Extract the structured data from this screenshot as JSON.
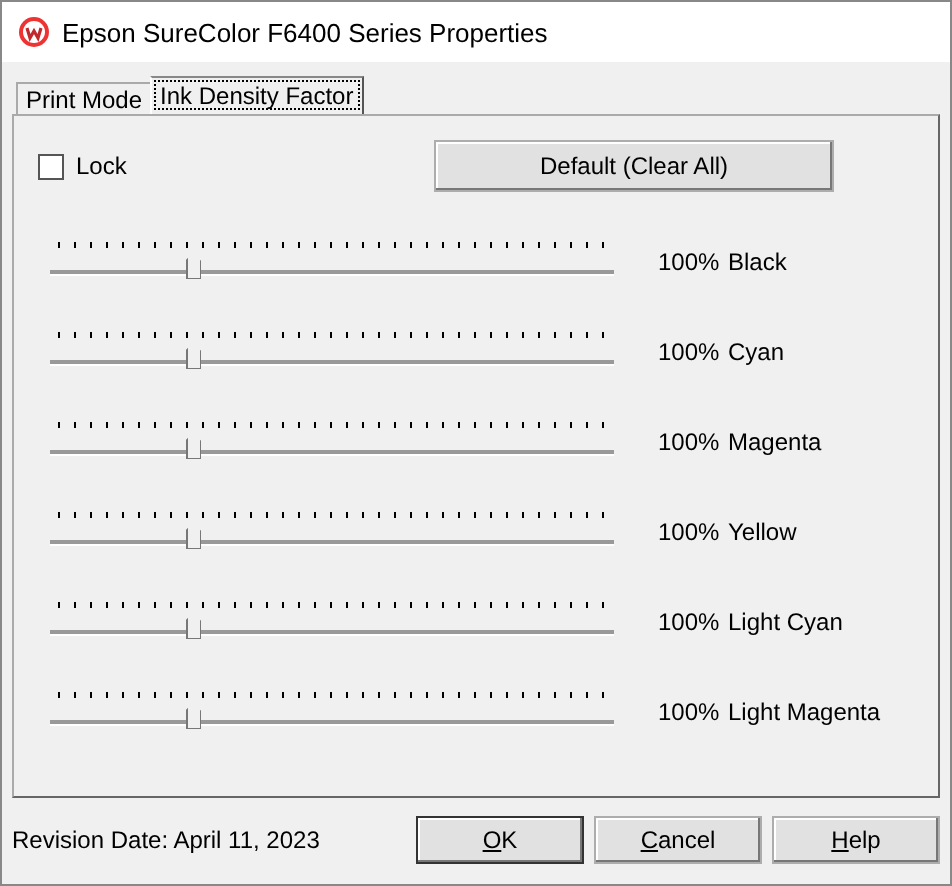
{
  "window": {
    "title": "Epson SureColor F6400 Series Properties"
  },
  "tabs": [
    {
      "label": "Print Mode",
      "selected": false
    },
    {
      "label": "Ink Density Factor",
      "selected": true
    }
  ],
  "lock": {
    "label": "Lock",
    "checked": false
  },
  "default_button": "Default (Clear All)",
  "sliders": [
    {
      "name": "Black",
      "level": 0.25,
      "reading": "100%"
    },
    {
      "name": "Cyan",
      "level": 0.25,
      "reading": "100%"
    },
    {
      "name": "Magenta",
      "level": 0.25,
      "reading": "100%"
    },
    {
      "name": "Yellow",
      "level": 0.25,
      "reading": "100%"
    },
    {
      "name": "Light Cyan",
      "level": 0.25,
      "reading": "100%"
    },
    {
      "name": "Light Magenta",
      "level": 0.25,
      "reading": "100%"
    }
  ],
  "status_bar": {
    "revision": "Revision Date: April 11, 2023"
  },
  "buttons": [
    {
      "label": "OK",
      "default": true
    },
    {
      "label": "Cancel",
      "default": false
    },
    {
      "label": "Help",
      "default": false
    }
  ]
}
